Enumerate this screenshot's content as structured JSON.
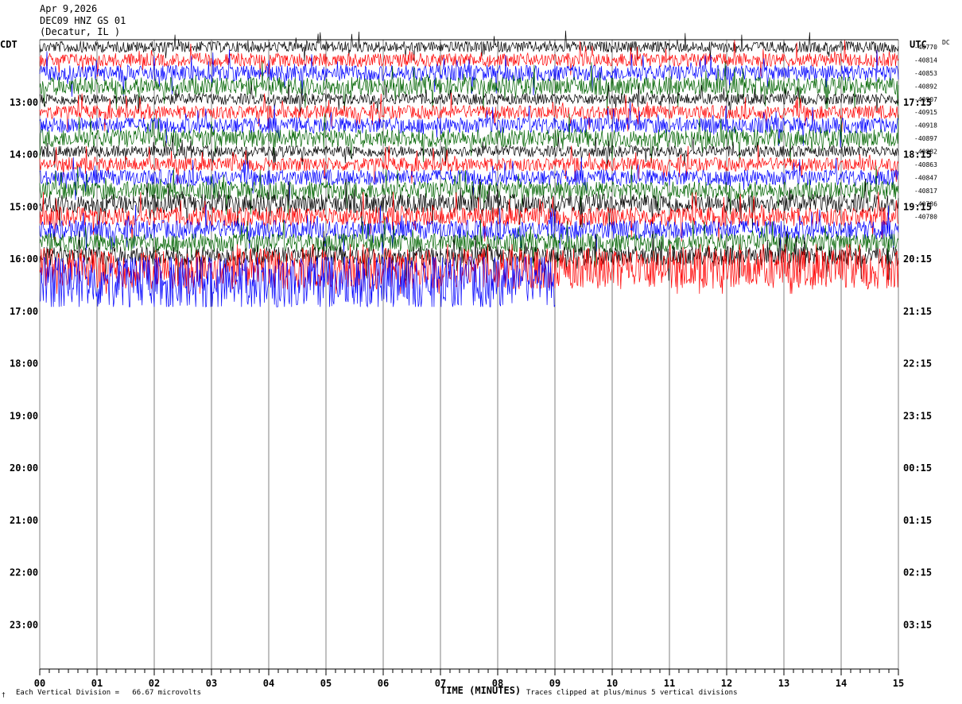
{
  "header": {
    "date": "Apr 9,2026",
    "station": "DEC09 HNZ GS 01",
    "subtitle": "(Decatur, IL )"
  },
  "left_tz": "CDT",
  "right_tz": "UTC",
  "dc_label": "DC",
  "footer": {
    "scale": "Each Vertical Division =   66.67 microvolts",
    "xlabel": "TIME (MINUTES)",
    "clip_note": "Traces clipped at plus/minus 5 vertical divisions",
    "corner": "†"
  },
  "colors": {
    "trace_cycle": [
      "#000000",
      "#ff0000",
      "#0000ff",
      "#006400"
    ],
    "grid": "#808080"
  },
  "chart_data": {
    "type": "line",
    "title": "DEC09 HNZ GS 01",
    "xlabel": "TIME (MINUTES)",
    "x_ticks": [
      "00",
      "01",
      "02",
      "03",
      "04",
      "05",
      "06",
      "07",
      "08",
      "09",
      "10",
      "11",
      "12",
      "13",
      "14",
      "15"
    ],
    "xlim": [
      0,
      15
    ],
    "left_hour_labels": [
      "13:00",
      "14:00",
      "15:00",
      "16:00",
      "17:00",
      "18:00",
      "19:00",
      "20:00",
      "21:00",
      "22:00",
      "23:00"
    ],
    "right_hour_labels": [
      "17:15",
      "18:15",
      "19:15",
      "20:15",
      "21:15",
      "22:15",
      "23:15",
      "00:15",
      "01:15",
      "02:15",
      "03:15"
    ],
    "first_hour_row": 4,
    "rows_per_hour": 4,
    "dc_offsets": [
      "-40770",
      "-40814",
      "-40853",
      "-40892",
      "-40907",
      "-40915",
      "-40918",
      "-40897",
      "-40882",
      "-40863",
      "-40847",
      "-40817",
      "-40786",
      "-40780"
    ],
    "trace_rows_total": 19,
    "last_full_row_end_minute": 15,
    "last_partial_row_end_minute": 9,
    "clip_divisions": 5
  }
}
